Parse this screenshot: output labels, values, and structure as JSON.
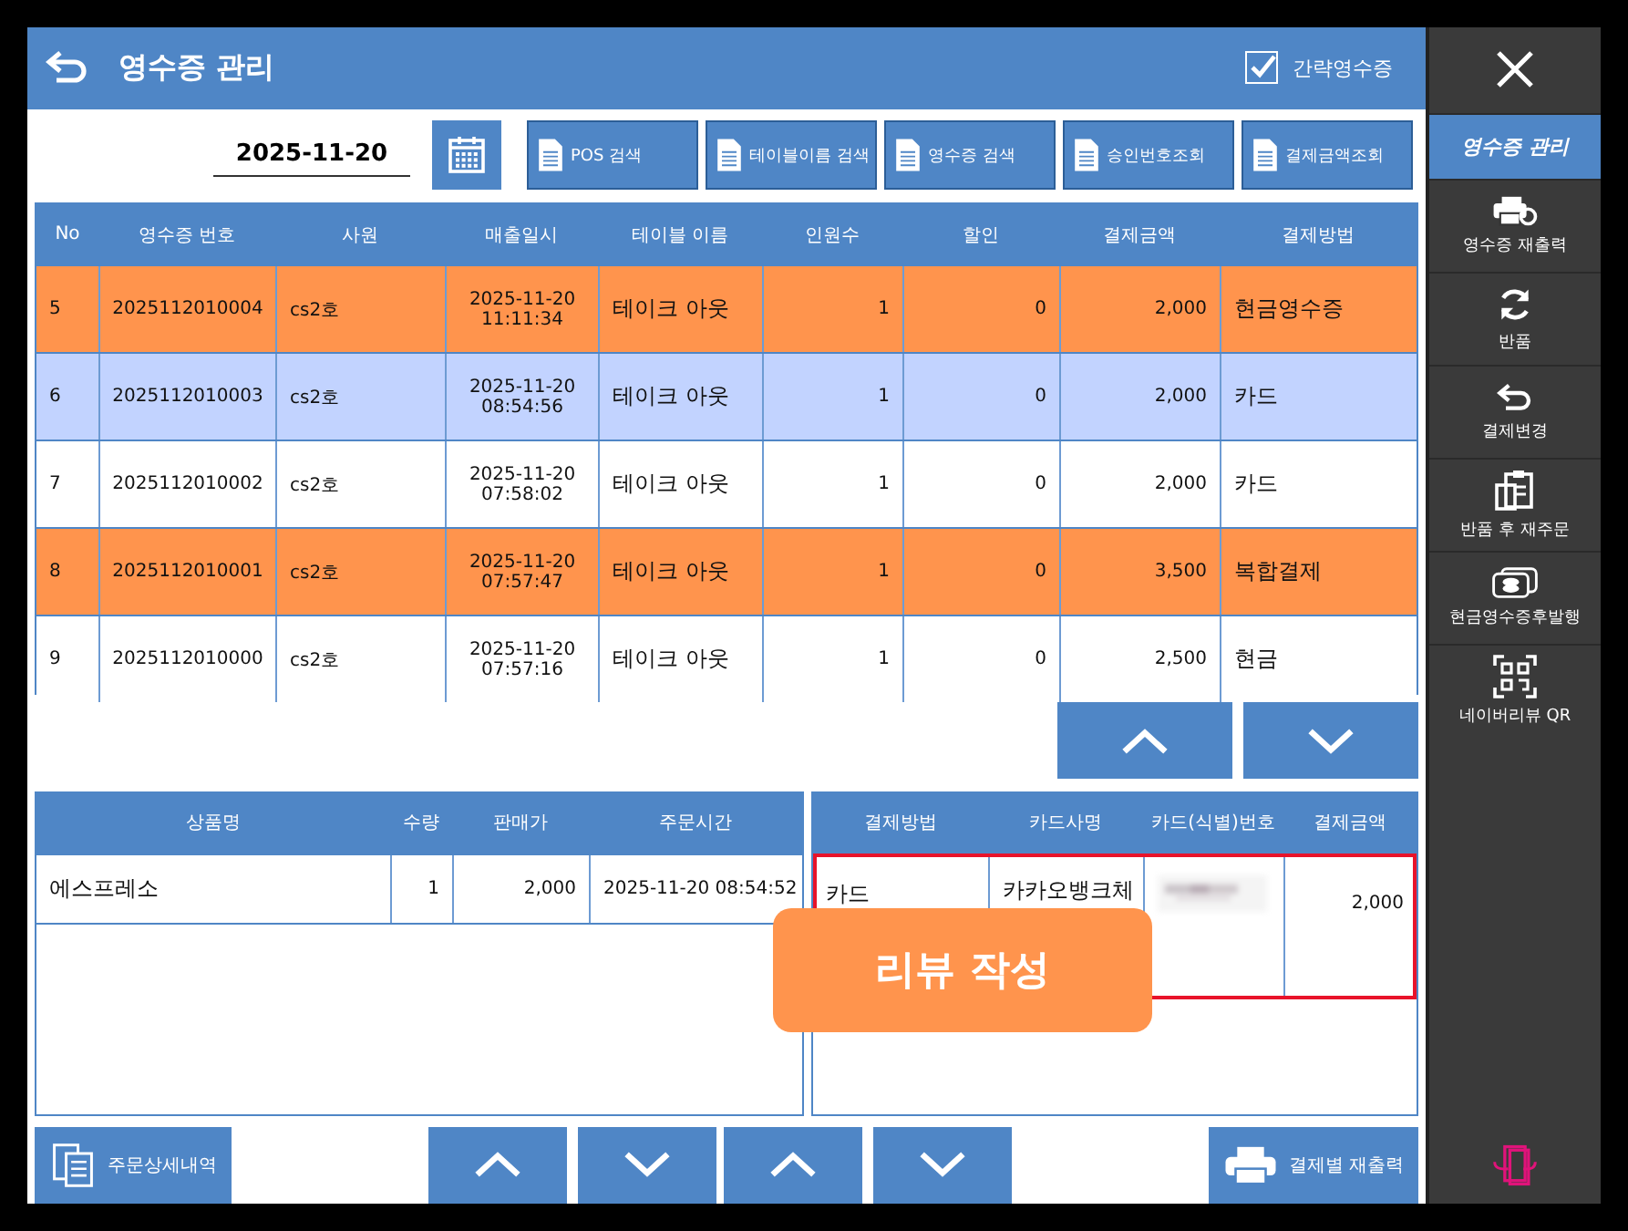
{
  "header": {
    "title": "영수증 관리",
    "simple_receipt": {
      "label": "간략영수증",
      "checked": true
    }
  },
  "toolbar": {
    "date": "2025-11-20",
    "buttons": [
      "POS 검색",
      "테이블이름 검색",
      "영수증 검색",
      "승인번호조회",
      "결제금액조회"
    ]
  },
  "receipts": {
    "columns": [
      "No",
      "영수증 번호",
      "사원",
      "매출일시",
      "테이블 이름",
      "인원수",
      "할인",
      "결제금액",
      "결제방법"
    ],
    "rows": [
      {
        "no": "5",
        "receipt": "2025112010004",
        "staff": "cs2호",
        "date": "2025-11-20",
        "time": "11:11:34",
        "table": "테이크 아웃",
        "people": "1",
        "discount": "0",
        "amount": "2,000",
        "method": "현금영수증",
        "highlighted": true,
        "selected": false
      },
      {
        "no": "6",
        "receipt": "2025112010003",
        "staff": "cs2호",
        "date": "2025-11-20",
        "time": "08:54:56",
        "table": "테이크 아웃",
        "people": "1",
        "discount": "0",
        "amount": "2,000",
        "method": "카드",
        "highlighted": false,
        "selected": true
      },
      {
        "no": "7",
        "receipt": "2025112010002",
        "staff": "cs2호",
        "date": "2025-11-20",
        "time": "07:58:02",
        "table": "테이크 아웃",
        "people": "1",
        "discount": "0",
        "amount": "2,000",
        "method": "카드",
        "highlighted": false,
        "selected": false
      },
      {
        "no": "8",
        "receipt": "2025112010001",
        "staff": "cs2호",
        "date": "2025-11-20",
        "time": "07:57:47",
        "table": "테이크 아웃",
        "people": "1",
        "discount": "0",
        "amount": "3,500",
        "method": "복합결제",
        "highlighted": true,
        "selected": false
      },
      {
        "no": "9",
        "receipt": "2025112010000",
        "staff": "cs2호",
        "date": "2025-11-20",
        "time": "07:57:16",
        "table": "테이크 아웃",
        "people": "1",
        "discount": "0",
        "amount": "2,500",
        "method": "현금",
        "highlighted": false,
        "selected": false
      }
    ]
  },
  "items": {
    "columns": [
      "상품명",
      "수량",
      "판매가",
      "주문시간"
    ],
    "rows": [
      {
        "name": "에스프레소",
        "qty": "1",
        "price": "2,000",
        "time": "2025-11-20 08:54:52"
      }
    ]
  },
  "payments": {
    "columns": [
      "결제방법",
      "카드사명",
      "카드(식별)번호",
      "결제금액"
    ],
    "rows": [
      {
        "method": "카드",
        "card": "카카오뱅크체",
        "amount": "2,000",
        "selected": true
      }
    ]
  },
  "review_badge": "리뷰 작성",
  "bottom_buttons": {
    "detail": "주문상세내역",
    "reprint": "결제별 재출력"
  },
  "sidebar": {
    "items": [
      {
        "kind": "tab",
        "label": "영수증 관리",
        "selected": true
      },
      {
        "kind": "printer",
        "label": "영수증 재출력",
        "selected": false
      },
      {
        "kind": "refresh",
        "label": "반품",
        "selected": false
      },
      {
        "kind": "undo",
        "label": "결제변경",
        "selected": false
      },
      {
        "kind": "clipboard",
        "label": "반품 후 재주문",
        "selected": false
      },
      {
        "kind": "cash",
        "label": "현금영수증후발행",
        "selected": false
      },
      {
        "kind": "qr",
        "label": "네이버리뷰 QR",
        "selected": false
      }
    ]
  }
}
